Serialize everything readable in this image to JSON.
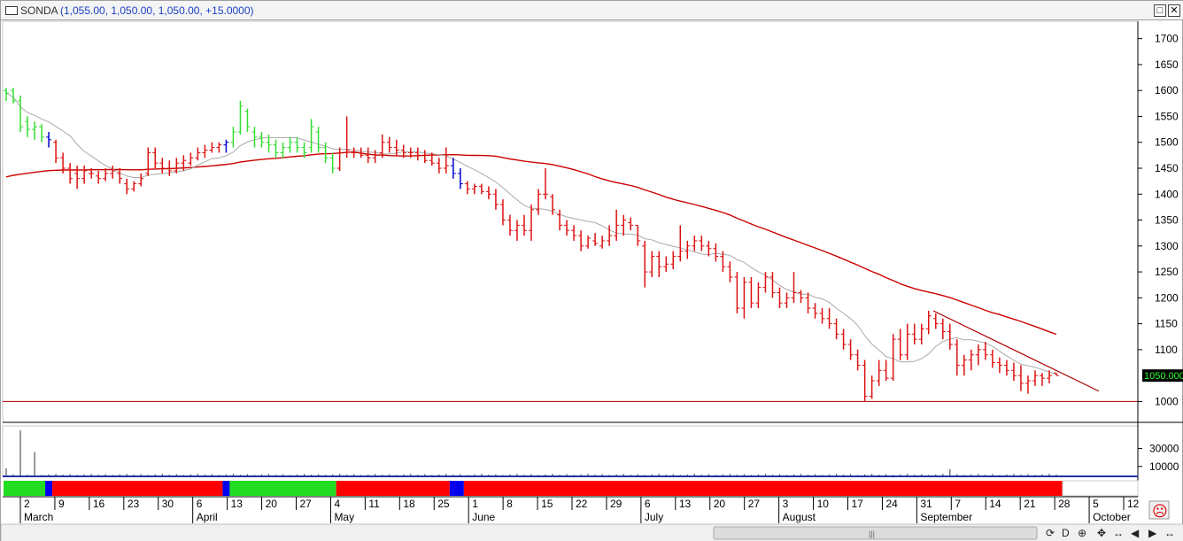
{
  "window": {
    "symbol": "SONDA",
    "quote": "(1,055.00, 1,050.00, 1,050.00, +15.0000)",
    "restore_glyph": "□",
    "close_glyph": "✕"
  },
  "chart_data": {
    "type": "bar",
    "subtype": "ohlc",
    "y_ticks": [
      "1700",
      "1650",
      "1600",
      "1550",
      "1500",
      "1450",
      "1400",
      "1350",
      "1300",
      "1250",
      "1200",
      "1150",
      "1100",
      "1050.000",
      "1000"
    ],
    "ylim": [
      970,
      1725
    ],
    "last_price_label": "1050.000",
    "last_price": 1050,
    "horizontal_line": 1000,
    "volume_ticks": [
      "30000",
      "10000"
    ],
    "volume_ylim": [
      0,
      52000
    ],
    "x_day_labels": [
      "2",
      "9",
      "16",
      "23",
      "30",
      "6",
      "13",
      "20",
      "27",
      "4",
      "11",
      "18",
      "25",
      "1",
      "8",
      "15",
      "22",
      "29",
      "6",
      "13",
      "20",
      "27",
      "3",
      "10",
      "17",
      "24",
      "31",
      "7",
      "14",
      "21",
      "28",
      "5",
      "12"
    ],
    "x_month_labels": [
      "March",
      "April",
      "May",
      "June",
      "July",
      "August",
      "September",
      "October"
    ],
    "x_month_label_indices": [
      0,
      5,
      9,
      13,
      18,
      22,
      26,
      31
    ],
    "trend_color_strip": [
      {
        "color": "#22dd22",
        "from": 0,
        "to": 6
      },
      {
        "color": "#0000ee",
        "from": 6,
        "to": 7
      },
      {
        "color": "#ff0000",
        "from": 7,
        "to": 31
      },
      {
        "color": "#0000ee",
        "from": 31,
        "to": 32
      },
      {
        "color": "#22dd22",
        "from": 32,
        "to": 47
      },
      {
        "color": "#ff0000",
        "from": 47,
        "to": 63
      },
      {
        "color": "#0000ee",
        "from": 63,
        "to": 65
      },
      {
        "color": "#ff0000",
        "from": 65,
        "to": 170
      }
    ],
    "series": [
      {
        "values": [
          [
            1600,
            1605,
            1580,
            1595
          ],
          [
            1600,
            1605,
            1575,
            1580
          ],
          [
            1580,
            1590,
            1520,
            1530
          ],
          [
            1540,
            1550,
            1510,
            1525
          ],
          [
            1525,
            1540,
            1505,
            1530
          ],
          [
            1530,
            1535,
            1500,
            1510
          ],
          [
            1510,
            1520,
            1490,
            1505
          ],
          [
            1500,
            1505,
            1460,
            1470
          ],
          [
            1470,
            1480,
            1440,
            1450
          ],
          [
            1450,
            1460,
            1420,
            1430
          ],
          [
            1440,
            1455,
            1410,
            1430
          ],
          [
            1430,
            1455,
            1420,
            1445
          ],
          [
            1440,
            1450,
            1430,
            1440
          ],
          [
            1435,
            1445,
            1420,
            1430
          ],
          [
            1430,
            1450,
            1425,
            1440
          ],
          [
            1440,
            1455,
            1430,
            1445
          ],
          [
            1440,
            1450,
            1420,
            1430
          ],
          [
            1420,
            1430,
            1400,
            1410
          ],
          [
            1410,
            1425,
            1405,
            1420
          ],
          [
            1420,
            1440,
            1415,
            1430
          ],
          [
            1440,
            1490,
            1435,
            1480
          ],
          [
            1480,
            1490,
            1450,
            1460
          ],
          [
            1460,
            1470,
            1440,
            1450
          ],
          [
            1450,
            1465,
            1435,
            1445
          ],
          [
            1445,
            1470,
            1440,
            1460
          ],
          [
            1460,
            1475,
            1445,
            1465
          ],
          [
            1460,
            1480,
            1455,
            1470
          ],
          [
            1470,
            1490,
            1465,
            1480
          ],
          [
            1480,
            1495,
            1470,
            1485
          ],
          [
            1485,
            1500,
            1480,
            1490
          ],
          [
            1490,
            1500,
            1480,
            1495
          ],
          [
            1495,
            1505,
            1480,
            1500
          ],
          [
            1500,
            1530,
            1490,
            1520
          ],
          [
            1520,
            1580,
            1515,
            1570
          ],
          [
            1560,
            1565,
            1520,
            1530
          ],
          [
            1520,
            1530,
            1490,
            1510
          ],
          [
            1510,
            1520,
            1490,
            1500
          ],
          [
            1500,
            1515,
            1480,
            1495
          ],
          [
            1495,
            1505,
            1470,
            1480
          ],
          [
            1480,
            1500,
            1470,
            1490
          ],
          [
            1490,
            1510,
            1480,
            1500
          ],
          [
            1500,
            1510,
            1480,
            1490
          ],
          [
            1490,
            1500,
            1470,
            1480
          ],
          [
            1490,
            1545,
            1480,
            1530
          ],
          [
            1520,
            1530,
            1480,
            1490
          ],
          [
            1490,
            1500,
            1460,
            1470
          ],
          [
            1470,
            1480,
            1440,
            1450
          ],
          [
            1450,
            1490,
            1445,
            1480
          ],
          [
            1480,
            1550,
            1470,
            1485
          ],
          [
            1480,
            1490,
            1470,
            1480
          ],
          [
            1480,
            1490,
            1470,
            1475
          ],
          [
            1475,
            1490,
            1460,
            1470
          ],
          [
            1470,
            1485,
            1460,
            1475
          ],
          [
            1480,
            1515,
            1470,
            1500
          ],
          [
            1500,
            1510,
            1480,
            1490
          ],
          [
            1490,
            1505,
            1475,
            1485
          ],
          [
            1485,
            1495,
            1470,
            1480
          ],
          [
            1480,
            1490,
            1470,
            1480
          ],
          [
            1480,
            1490,
            1465,
            1475
          ],
          [
            1475,
            1485,
            1460,
            1465
          ],
          [
            1465,
            1480,
            1455,
            1460
          ],
          [
            1460,
            1470,
            1440,
            1450
          ],
          [
            1450,
            1490,
            1440,
            1455
          ],
          [
            1455,
            1470,
            1430,
            1440
          ],
          [
            1440,
            1450,
            1410,
            1420
          ],
          [
            1420,
            1425,
            1400,
            1410
          ],
          [
            1410,
            1420,
            1400,
            1415
          ],
          [
            1415,
            1420,
            1400,
            1405
          ],
          [
            1405,
            1415,
            1390,
            1400
          ],
          [
            1400,
            1410,
            1370,
            1380
          ],
          [
            1380,
            1390,
            1340,
            1350
          ],
          [
            1350,
            1360,
            1320,
            1330
          ],
          [
            1330,
            1350,
            1310,
            1340
          ],
          [
            1340,
            1360,
            1320,
            1330
          ],
          [
            1330,
            1380,
            1310,
            1370
          ],
          [
            1370,
            1410,
            1360,
            1400
          ],
          [
            1400,
            1450,
            1390,
            1400
          ],
          [
            1395,
            1400,
            1360,
            1370
          ],
          [
            1360,
            1370,
            1330,
            1340
          ],
          [
            1340,
            1350,
            1320,
            1330
          ],
          [
            1330,
            1340,
            1310,
            1320
          ],
          [
            1320,
            1330,
            1290,
            1300
          ],
          [
            1300,
            1320,
            1295,
            1315
          ],
          [
            1310,
            1325,
            1300,
            1305
          ],
          [
            1300,
            1320,
            1295,
            1310
          ],
          [
            1310,
            1340,
            1300,
            1320
          ],
          [
            1320,
            1370,
            1310,
            1340
          ],
          [
            1340,
            1360,
            1320,
            1350
          ],
          [
            1345,
            1355,
            1330,
            1340
          ],
          [
            1340,
            1340,
            1300,
            1310
          ],
          [
            1300,
            1310,
            1220,
            1250
          ],
          [
            1250,
            1290,
            1240,
            1280
          ],
          [
            1280,
            1290,
            1240,
            1260
          ],
          [
            1260,
            1280,
            1250,
            1265
          ],
          [
            1265,
            1290,
            1255,
            1280
          ],
          [
            1280,
            1340,
            1270,
            1290
          ],
          [
            1290,
            1310,
            1275,
            1300
          ],
          [
            1300,
            1320,
            1290,
            1310
          ],
          [
            1310,
            1320,
            1290,
            1300
          ],
          [
            1300,
            1310,
            1280,
            1295
          ],
          [
            1295,
            1305,
            1270,
            1280
          ],
          [
            1280,
            1290,
            1250,
            1260
          ],
          [
            1260,
            1270,
            1230,
            1240
          ],
          [
            1240,
            1250,
            1170,
            1180
          ],
          [
            1180,
            1240,
            1160,
            1230
          ],
          [
            1230,
            1240,
            1180,
            1190
          ],
          [
            1190,
            1230,
            1180,
            1220
          ],
          [
            1220,
            1250,
            1210,
            1240
          ],
          [
            1240,
            1250,
            1200,
            1210
          ],
          [
            1210,
            1220,
            1180,
            1190
          ],
          [
            1190,
            1210,
            1180,
            1200
          ],
          [
            1200,
            1250,
            1190,
            1210
          ],
          [
            1210,
            1215,
            1190,
            1200
          ],
          [
            1200,
            1210,
            1170,
            1180
          ],
          [
            1180,
            1190,
            1160,
            1170
          ],
          [
            1170,
            1180,
            1150,
            1160
          ],
          [
            1160,
            1180,
            1140,
            1150
          ],
          [
            1150,
            1160,
            1120,
            1130
          ],
          [
            1130,
            1140,
            1100,
            1110
          ],
          [
            1110,
            1120,
            1080,
            1090
          ],
          [
            1090,
            1100,
            1060,
            1070
          ],
          [
            1070,
            1080,
            1000,
            1010
          ],
          [
            1010,
            1050,
            1005,
            1040
          ],
          [
            1040,
            1080,
            1030,
            1060
          ],
          [
            1060,
            1080,
            1040,
            1045
          ],
          [
            1045,
            1130,
            1040,
            1120
          ],
          [
            1120,
            1140,
            1080,
            1090
          ],
          [
            1090,
            1150,
            1080,
            1130
          ],
          [
            1130,
            1150,
            1110,
            1120
          ],
          [
            1120,
            1150,
            1110,
            1140
          ],
          [
            1140,
            1175,
            1130,
            1165
          ],
          [
            1160,
            1170,
            1140,
            1150
          ],
          [
            1150,
            1160,
            1120,
            1135
          ],
          [
            1135,
            1150,
            1100,
            1110
          ],
          [
            1110,
            1120,
            1050,
            1070
          ],
          [
            1070,
            1090,
            1050,
            1080
          ],
          [
            1080,
            1100,
            1060,
            1090
          ],
          [
            1090,
            1110,
            1070,
            1100
          ],
          [
            1100,
            1115,
            1080,
            1090
          ],
          [
            1090,
            1100,
            1065,
            1075
          ],
          [
            1075,
            1085,
            1055,
            1070
          ],
          [
            1070,
            1080,
            1050,
            1060
          ],
          [
            1060,
            1075,
            1040,
            1050
          ],
          [
            1050,
            1070,
            1020,
            1035
          ],
          [
            1035,
            1050,
            1015,
            1040
          ],
          [
            1040,
            1060,
            1030,
            1050
          ],
          [
            1050,
            1055,
            1030,
            1045
          ],
          [
            1045,
            1060,
            1035,
            1050
          ],
          [
            1055,
            1055,
            1050,
            1050
          ]
        ]
      }
    ],
    "bar_colors": "red when close below a rising-period trend (downtrend), blue when neutral, green in uptrend",
    "moving_average_long_color": "#cc0000",
    "moving_average_short_color": "#aaaaaa",
    "trendline": {
      "from": [
        1053,
        1175
      ],
      "to": [
        1240,
        1020
      ],
      "color": "#aa0000"
    }
  },
  "status": {
    "face_icon": "☹",
    "scroll_glyphs": [
      "⟳",
      "D",
      "⊕",
      "✥",
      "↔",
      "◀",
      "▶",
      "↔"
    ]
  }
}
